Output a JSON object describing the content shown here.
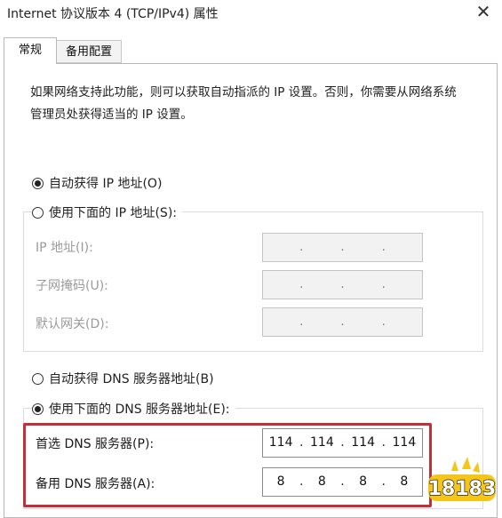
{
  "window": {
    "title": "Internet 协议版本 4 (TCP/IPv4) 属性",
    "close_glyph": "✕"
  },
  "tabs": [
    {
      "label": "常规"
    },
    {
      "label": "备用配置"
    }
  ],
  "description": "如果网络支持此功能，则可以获取自动指派的 IP 设置。否则，你需要从网络系统管理员处获得适当的 IP 设置。",
  "ip_mode": {
    "auto_label": "自动获得 IP 地址(O)",
    "manual_label": "使用下面的 IP 地址(S):",
    "selected": "auto"
  },
  "ip_fields": [
    {
      "label": "IP 地址(I):",
      "octets": [
        "",
        "",
        "",
        ""
      ]
    },
    {
      "label": "子网掩码(U):",
      "octets": [
        "",
        "",
        "",
        ""
      ]
    },
    {
      "label": "默认网关(D):",
      "octets": [
        "",
        "",
        "",
        ""
      ]
    }
  ],
  "dns_mode": {
    "auto_label": "自动获得 DNS 服务器地址(B)",
    "manual_label": "使用下面的 DNS 服务器地址(E):",
    "selected": "manual"
  },
  "dns_fields": [
    {
      "label": "首选 DNS 服务器(P):",
      "octets": [
        "114",
        "114",
        "114",
        "114"
      ]
    },
    {
      "label": "备用 DNS 服务器(A):",
      "octets": [
        "8",
        "8",
        "8",
        "8"
      ]
    }
  ],
  "octet_separator": ".",
  "watermark": {
    "text": "18183"
  },
  "colors": {
    "highlight": "#c0303b",
    "watermark_yellow": "#f5c518",
    "disabled_text": "#9a9a9a"
  }
}
